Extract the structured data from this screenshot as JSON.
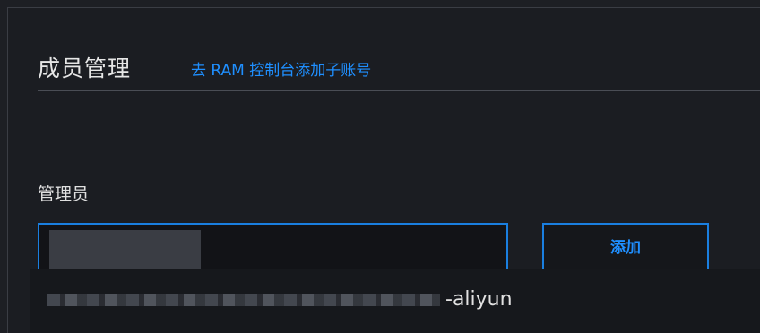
{
  "header": {
    "title": "成员管理",
    "ram_link": "去 RAM 控制台添加子账号"
  },
  "admin": {
    "label": "管理员",
    "input_value": "",
    "add_button": "添加"
  },
  "members": [
    {
      "name_suffix": "-aliyun"
    }
  ],
  "colors": {
    "accent": "#1f8fff",
    "background": "#1b1d22"
  }
}
